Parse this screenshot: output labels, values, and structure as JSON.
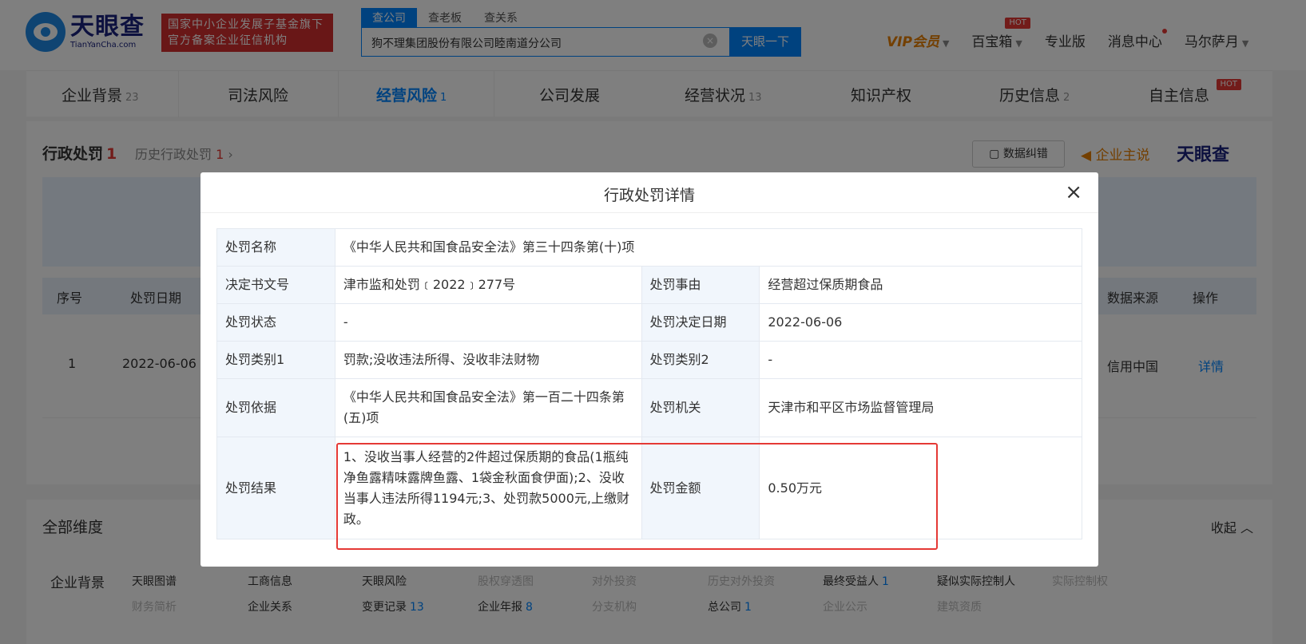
{
  "header": {
    "logo_cn": "天眼查",
    "logo_en": "TianYanCha.com",
    "badge_line1": "国家中小企业发展子基金旗下",
    "badge_line2": "官方备案企业征信机构",
    "search_tabs": [
      "查公司",
      "查老板",
      "查关系"
    ],
    "search_value": "狗不理集团股份有限公司睦南道分公司",
    "search_button": "天眼一下",
    "nav": {
      "vip": "VIP会员",
      "baibaoxiang": "百宝箱",
      "hot": "HOT",
      "pro": "专业版",
      "messages": "消息中心",
      "user": "马尔萨月"
    }
  },
  "dimtabs": [
    {
      "label": "企业背景",
      "count": "23"
    },
    {
      "label": "司法风险",
      "count": ""
    },
    {
      "label": "经营风险",
      "count": "1"
    },
    {
      "label": "公司发展",
      "count": ""
    },
    {
      "label": "经营状况",
      "count": "13"
    },
    {
      "label": "知识产权",
      "count": ""
    },
    {
      "label": "历史信息",
      "count": "2"
    },
    {
      "label": "自主信息",
      "count": "",
      "hot": "HOT"
    }
  ],
  "section": {
    "title": "行政处罚",
    "count": "1",
    "history_title": "历史行政处罚",
    "history_count": "1",
    "data_error": "数据纠错",
    "claim": "企业主说",
    "brand": "天眼查"
  },
  "bg_table": {
    "headers": {
      "seq": "序号",
      "date": "处罚日期",
      "source": "数据来源",
      "op": "操作"
    },
    "row": {
      "seq": "1",
      "date": "2022-06-06",
      "source": "信用中国",
      "op": "详情"
    }
  },
  "all_dims": {
    "title": "全部维度",
    "collapse": "收起",
    "row_label": "企业背景",
    "row1": [
      {
        "label": "天眼图谱",
        "count": "",
        "muted": false
      },
      {
        "label": "工商信息",
        "count": "",
        "muted": false
      },
      {
        "label": "天眼风险",
        "count": "",
        "muted": false
      },
      {
        "label": "股权穿透图",
        "count": "",
        "muted": true
      },
      {
        "label": "对外投资",
        "count": "",
        "muted": true
      },
      {
        "label": "历史对外投资",
        "count": "",
        "muted": true
      },
      {
        "label": "最终受益人",
        "count": "1",
        "muted": false
      },
      {
        "label": "疑似实际控制人",
        "count": "",
        "muted": false
      },
      {
        "label": "实际控制权",
        "count": "",
        "muted": true
      }
    ],
    "row2": [
      {
        "label": "财务简析",
        "count": "",
        "muted": true
      },
      {
        "label": "企业关系",
        "count": "",
        "muted": false
      },
      {
        "label": "变更记录",
        "count": "13",
        "muted": false
      },
      {
        "label": "企业年报",
        "count": "8",
        "muted": false
      },
      {
        "label": "分支机构",
        "count": "",
        "muted": true
      },
      {
        "label": "总公司",
        "count": "1",
        "muted": false
      },
      {
        "label": "企业公示",
        "count": "",
        "muted": true
      },
      {
        "label": "建筑资质",
        "count": "",
        "muted": true
      }
    ]
  },
  "modal": {
    "title": "行政处罚详情",
    "close": "×",
    "rows": {
      "name_k": "处罚名称",
      "name_v": "《中华人民共和国食品安全法》第三十四条第(十)项",
      "doc_k": "决定书文号",
      "doc_v": "津市监和处罚﹝2022﹞277号",
      "reason_k": "处罚事由",
      "reason_v": "经营超过保质期食品",
      "status_k": "处罚状态",
      "status_v": "-",
      "date_k": "处罚决定日期",
      "date_v": "2022-06-06",
      "type1_k": "处罚类别1",
      "type1_v": "罚款;没收违法所得、没收非法财物",
      "type2_k": "处罚类别2",
      "type2_v": "-",
      "basis_k": "处罚依据",
      "basis_v": "《中华人民共和国食品安全法》第一百二十四条第(五)项",
      "org_k": "处罚机关",
      "org_v": "天津市和平区市场监督管理局",
      "result_k": "处罚结果",
      "result_v": "1、没收当事人经营的2件超过保质期的食品(1瓶纯净鱼露精味露牌鱼露、1袋金秋面食伊面);2、没收当事人违法所得1194元;3、处罚款5000元,上缴财政。",
      "amount_k": "处罚金额",
      "amount_v": "0.50万元"
    }
  },
  "colors": {
    "primary": "#0084ff",
    "highlight": "#e53935",
    "vip": "#e67e00"
  }
}
